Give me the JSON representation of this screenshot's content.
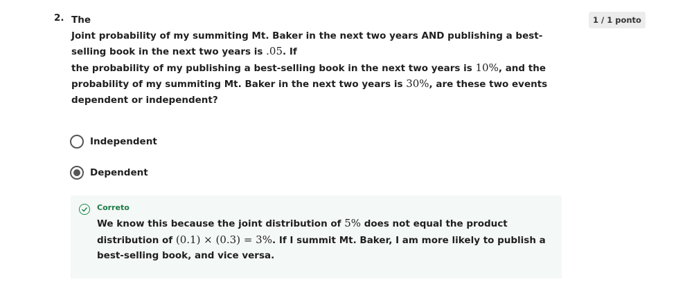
{
  "question": {
    "number": "2.",
    "line1": "The",
    "p2_a": "Joint probability of my summiting Mt. Baker in the next two years AND publishing a best-selling book in the next two years is ",
    "p2_m": ".05",
    "p2_b": ". If",
    "p3_a": "the probability of my publishing a best-selling book in the next two years is ",
    "p3_m1": "10%",
    "p3_b": ", and the probability of my summiting Mt. Baker in the next two years is ",
    "p3_m2": "30%",
    "p3_c": ", are these two events dependent or independent?"
  },
  "score": "1 / 1 ponto",
  "options": [
    {
      "label": "Independent",
      "selected": false
    },
    {
      "label": "Dependent",
      "selected": true
    }
  ],
  "feedback": {
    "title": "Correto",
    "t1": "We know this because the joint distribution of ",
    "m1": "5%",
    "t2": " does not equal the product distribution of ",
    "m2": "(0.1) × (0.3) = 3%",
    "t3": ". If I summit Mt. Baker, I am more likely to publish a best-selling book, and vice versa.",
    "color": "#1a7a45"
  }
}
